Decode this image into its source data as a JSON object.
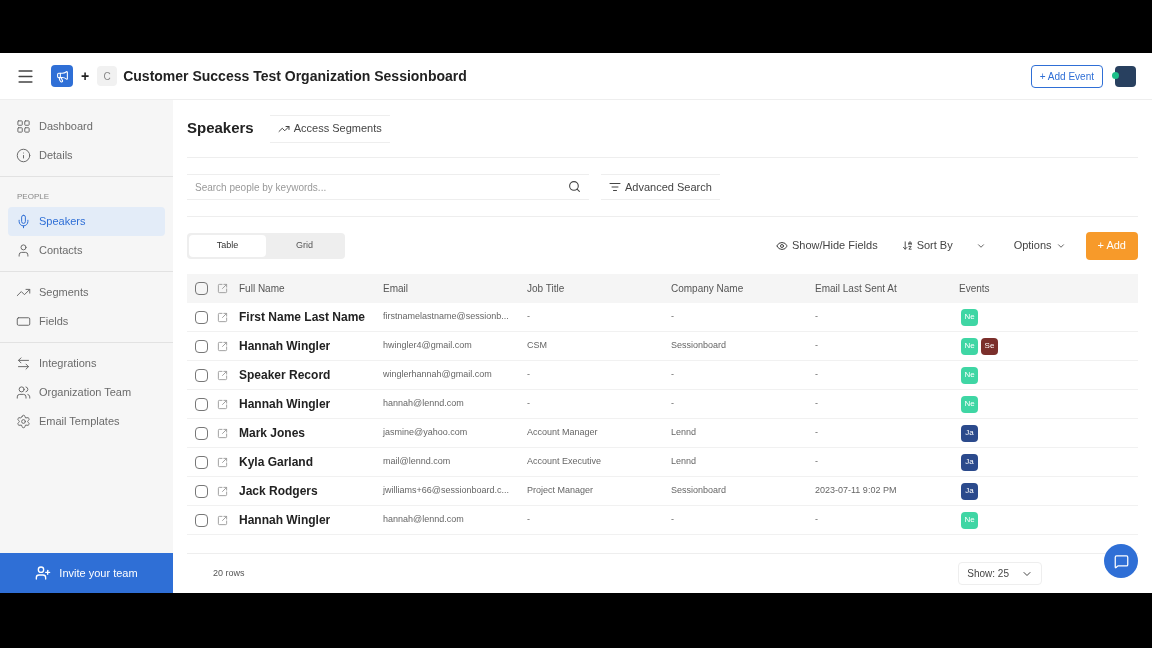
{
  "header": {
    "plus": "+",
    "org_initial": "C",
    "title": "Customer Success Test Organization Sessionboard",
    "add_event": "+ Add Event"
  },
  "sidebar": {
    "sections": [
      {
        "items": [
          {
            "label": "Dashboard",
            "selected": false
          },
          {
            "label": "Details",
            "selected": false
          }
        ]
      },
      {
        "label": "PEOPLE",
        "items": [
          {
            "label": "Speakers",
            "selected": true
          },
          {
            "label": "Contacts",
            "selected": false
          }
        ]
      },
      {
        "items": [
          {
            "label": "Segments",
            "selected": false
          },
          {
            "label": "Fields",
            "selected": false
          }
        ]
      },
      {
        "items": [
          {
            "label": "Integrations",
            "selected": false
          },
          {
            "label": "Organization Team",
            "selected": false
          },
          {
            "label": "Email Templates",
            "selected": false
          }
        ]
      }
    ],
    "invite": "Invite your team"
  },
  "page": {
    "title": "Speakers",
    "access_segments": "Access Segments",
    "search": {
      "placeholder": "Search people by keywords..."
    },
    "advanced_search": "Advanced Search",
    "views": [
      {
        "label": "Table",
        "selected": true
      },
      {
        "label": "Grid",
        "selected": false
      }
    ],
    "show_hide": "Show/Hide Fields",
    "sort_by": "Sort By",
    "options": "Options",
    "add": "+ Add"
  },
  "table": {
    "all_checked": false,
    "columns": [
      "Full Name",
      "Email",
      "Job Title",
      "Company Name",
      "Email Last Sent At",
      "Events"
    ],
    "rows": [
      {
        "name": "First Name Last Name",
        "email": "firstnamelastname@sessionb...",
        "job": "-",
        "company": "-",
        "sent": "-",
        "checked": false,
        "events": [
          {
            "label": "Ne",
            "color": "#3fd6a4"
          }
        ]
      },
      {
        "name": "Hannah Wingler",
        "email": "hwingler4@gmail.com",
        "job": "CSM",
        "company": "Sessionboard",
        "sent": "-",
        "checked": false,
        "events": [
          {
            "label": "Ne",
            "color": "#3fd6a4"
          },
          {
            "label": "Se",
            "color": "#7b2f2b"
          }
        ]
      },
      {
        "name": "Speaker Record",
        "email": "winglerhannah@gmail.com",
        "job": "-",
        "company": "-",
        "sent": "-",
        "checked": false,
        "events": [
          {
            "label": "Ne",
            "color": "#3fd6a4"
          }
        ]
      },
      {
        "name": "Hannah Wingler",
        "email": "hannah@lennd.com",
        "job": "-",
        "company": "-",
        "sent": "-",
        "checked": false,
        "events": [
          {
            "label": "Ne",
            "color": "#3fd6a4"
          }
        ]
      },
      {
        "name": "Mark Jones",
        "email": "jasmine@yahoo.com",
        "job": "Account Manager",
        "company": "Lennd",
        "sent": "-",
        "checked": false,
        "events": [
          {
            "label": "Ja",
            "color": "#2b4a8c"
          }
        ]
      },
      {
        "name": "Kyla Garland",
        "email": "mail@lennd.com",
        "job": "Account Executive",
        "company": "Lennd",
        "sent": "-",
        "checked": false,
        "events": [
          {
            "label": "Ja",
            "color": "#2b4a8c"
          }
        ]
      },
      {
        "name": "Jack Rodgers",
        "email": "jwilliams+66@sessionboard.c...",
        "job": "Project Manager",
        "company": "Sessionboard",
        "sent": "2023-07-11 9:02 PM",
        "checked": false,
        "events": [
          {
            "label": "Ja",
            "color": "#2b4a8c"
          }
        ]
      },
      {
        "name": "Hannah Wingler",
        "email": "hannah@lennd.com",
        "job": "-",
        "company": "-",
        "sent": "-",
        "checked": false,
        "events": [
          {
            "label": "Ne",
            "color": "#3fd6a4"
          }
        ]
      }
    ],
    "row_count": "20 rows",
    "show": "Show: 25"
  }
}
